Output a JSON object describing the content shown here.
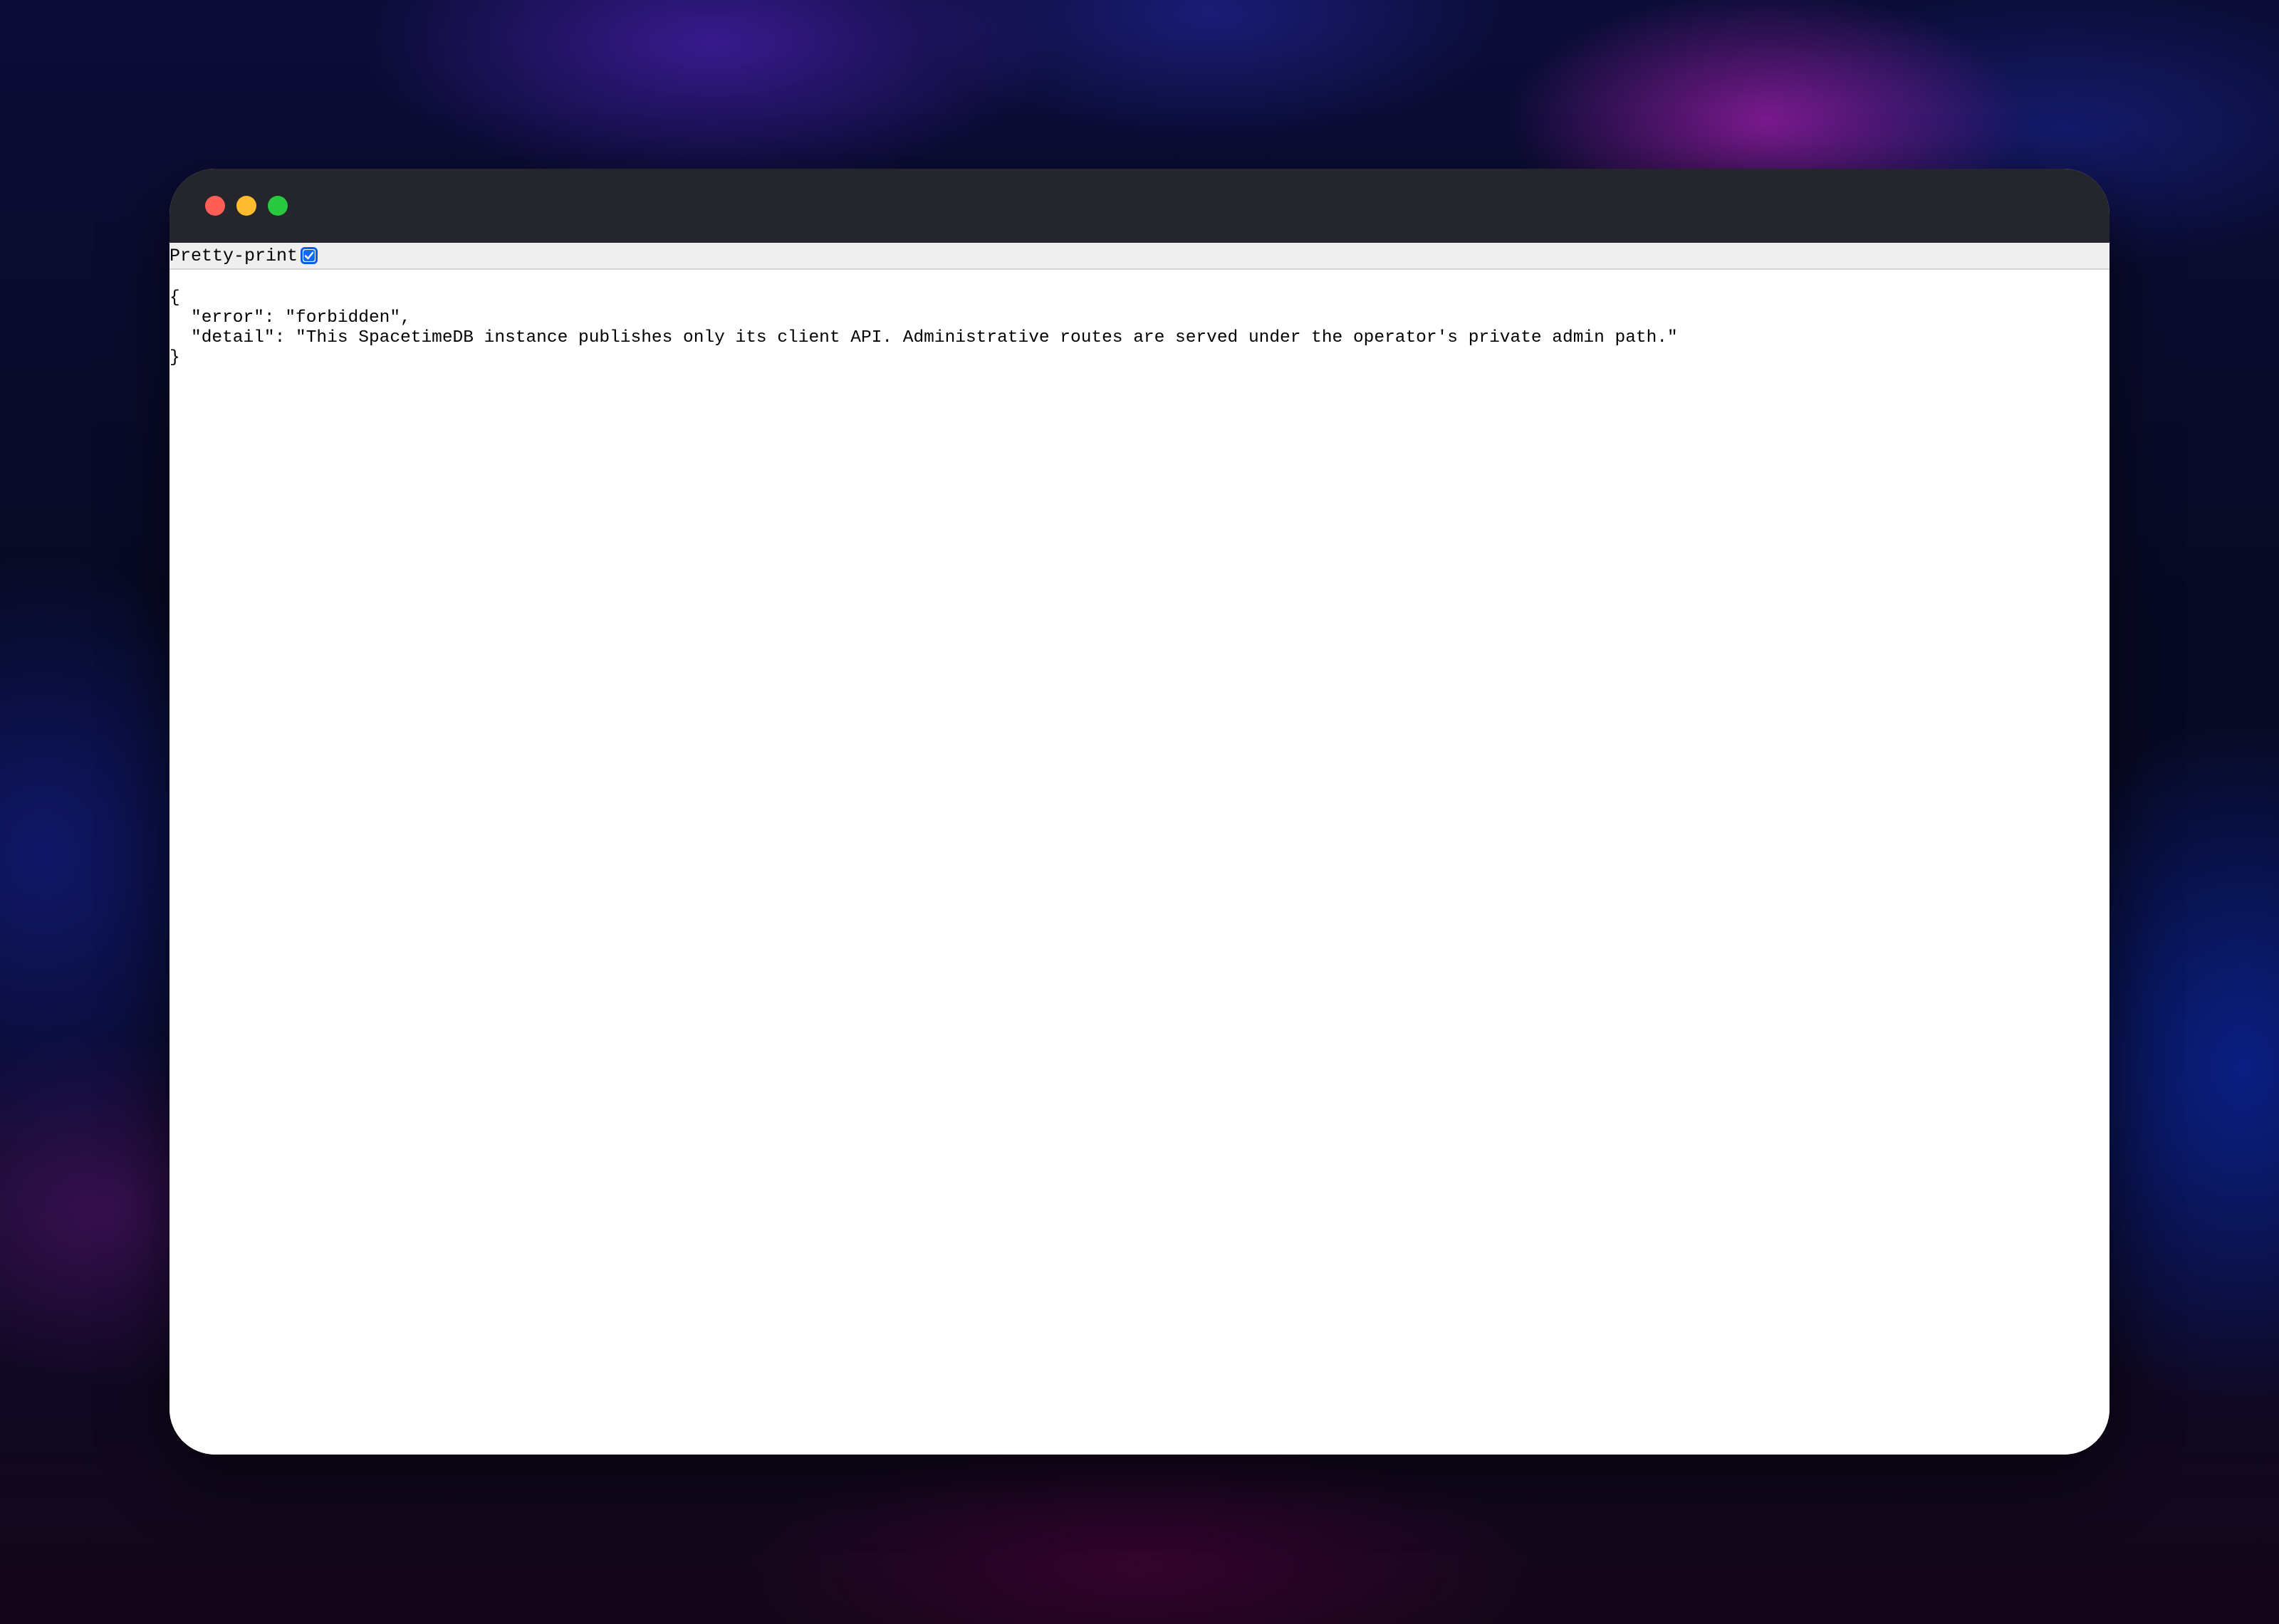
{
  "window": {
    "controls": {
      "close": "close-icon",
      "minimize": "minimize-icon",
      "zoom": "zoom-icon"
    }
  },
  "toolbar": {
    "pretty_print_label": "Pretty-print",
    "pretty_print_checked": true
  },
  "json_body": {
    "open_brace": "{",
    "line_error": "\"error\": \"forbidden\",",
    "line_detail": "\"detail\": \"This SpacetimeDB instance publishes only its client API. Administrative routes are served under the operator's private admin path.\"",
    "close_brace": "}"
  },
  "colors": {
    "titlebar": "#25262b",
    "close": "#ff5f57",
    "minimize": "#febc2e",
    "zoom": "#28c840",
    "checkbox_accent": "#0a6cf0"
  }
}
